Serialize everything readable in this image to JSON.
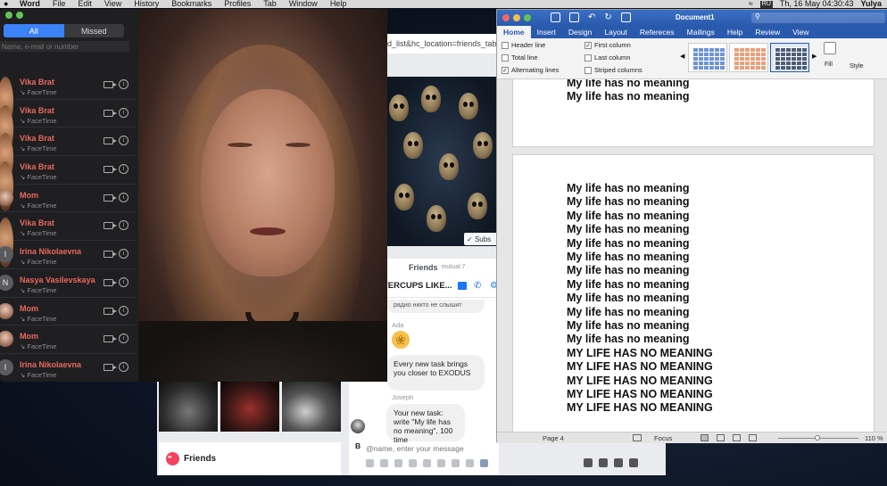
{
  "menubar": {
    "items": [
      "Word",
      "File",
      "Edit",
      "View",
      "History",
      "Bookmarks",
      "Profiles",
      "Tab",
      "Window",
      "Help"
    ],
    "input_source": "RU",
    "datetime": "Th, 16 May  04:30:43",
    "user": "Yulya"
  },
  "facetime": {
    "tabs": [
      "All",
      "Missed"
    ],
    "search_placeholder": "Name, e-mail or number",
    "contacts": [
      {
        "name": "Vika Brat",
        "sub": "FaceTime",
        "avatar": "photo"
      },
      {
        "name": "Vika Brat",
        "sub": "FaceTime",
        "avatar": "photo"
      },
      {
        "name": "Vika Brat",
        "sub": "FaceTime",
        "avatar": "photo"
      },
      {
        "name": "Vika Brat",
        "sub": "FaceTime",
        "avatar": "photo"
      },
      {
        "name": "Mom",
        "sub": "FaceTime",
        "avatar": "mom"
      },
      {
        "name": "Vika Brat",
        "sub": "FaceTime",
        "avatar": "photo"
      },
      {
        "name": "Irina Nikolaevna",
        "sub": "FaceTime",
        "avatar": "I"
      },
      {
        "name": "Nasya Vasilevskaya",
        "sub": "FaceTime",
        "avatar": "N"
      },
      {
        "name": "Mom",
        "sub": "FaceTime",
        "avatar": "mom"
      },
      {
        "name": "Mom",
        "sub": "FaceTime",
        "avatar": "mom"
      },
      {
        "name": "Irina Nikolaevna",
        "sub": "FaceTime",
        "avatar": "I"
      }
    ]
  },
  "browser": {
    "url_fragment": "d_list&hc_location=friends_tab",
    "subscribe_label": "Subs",
    "friends_tab_label": "Friends",
    "friends_mutual": "mutual:7",
    "chat_title": "TERCUPS LIKE...",
    "messages": [
      {
        "sender": "",
        "text": "радио никто не слышит"
      },
      {
        "sender": "Ada",
        "text": "clap"
      },
      {
        "sender": "",
        "text": "Every new task brings you closer to EXODUS"
      },
      {
        "sender": "Joseph",
        "text": "Your new task: write \"My life has no meaning\", 100 time"
      }
    ],
    "message_placeholder": "@name, enter your message",
    "friends_card_label": "Friends",
    "br_label": "B"
  },
  "word": {
    "doc_title": "Document1",
    "ribbon_tabs": [
      "Home",
      "Insert",
      "Design",
      "Layout",
      "Refereces",
      "Mailings",
      "Help",
      "Review",
      "View"
    ],
    "active_tab": "Home",
    "options": [
      {
        "label": "Header line",
        "checked": false
      },
      {
        "label": "Total line",
        "checked": false
      },
      {
        "label": "Alternating lines",
        "checked": true
      },
      {
        "label": "First column",
        "checked": true
      },
      {
        "label": "Last column",
        "checked": false
      },
      {
        "label": "Striped columns",
        "checked": false
      }
    ],
    "fill_label": "Fill",
    "style_label": "Style",
    "page1_lines": [
      "My life has no meaning",
      "My life has no meaning"
    ],
    "page2_lines": [
      "My life has no meaning",
      "My life has no meaning",
      "My life has no meaning",
      "My life has no meaning",
      "My life has no meaning",
      "My life has no meaning",
      "My life has no meaning",
      "My life has no meaning",
      "My life has no meaning",
      "My life has no meaning",
      "My life has no meaning",
      "My life has no meaning",
      "MY LIFE HAS NO MEANING",
      "MY LIFE HAS NO MEANING",
      "MY LIFE HAS NO MEANING",
      "MY LIFE HAS NO MEANING",
      "MY LIFE HAS NO MEANING"
    ],
    "status": {
      "page": "Page 4",
      "focus": "Focus",
      "zoom": "110 %",
      "zoom_value": 110
    }
  }
}
